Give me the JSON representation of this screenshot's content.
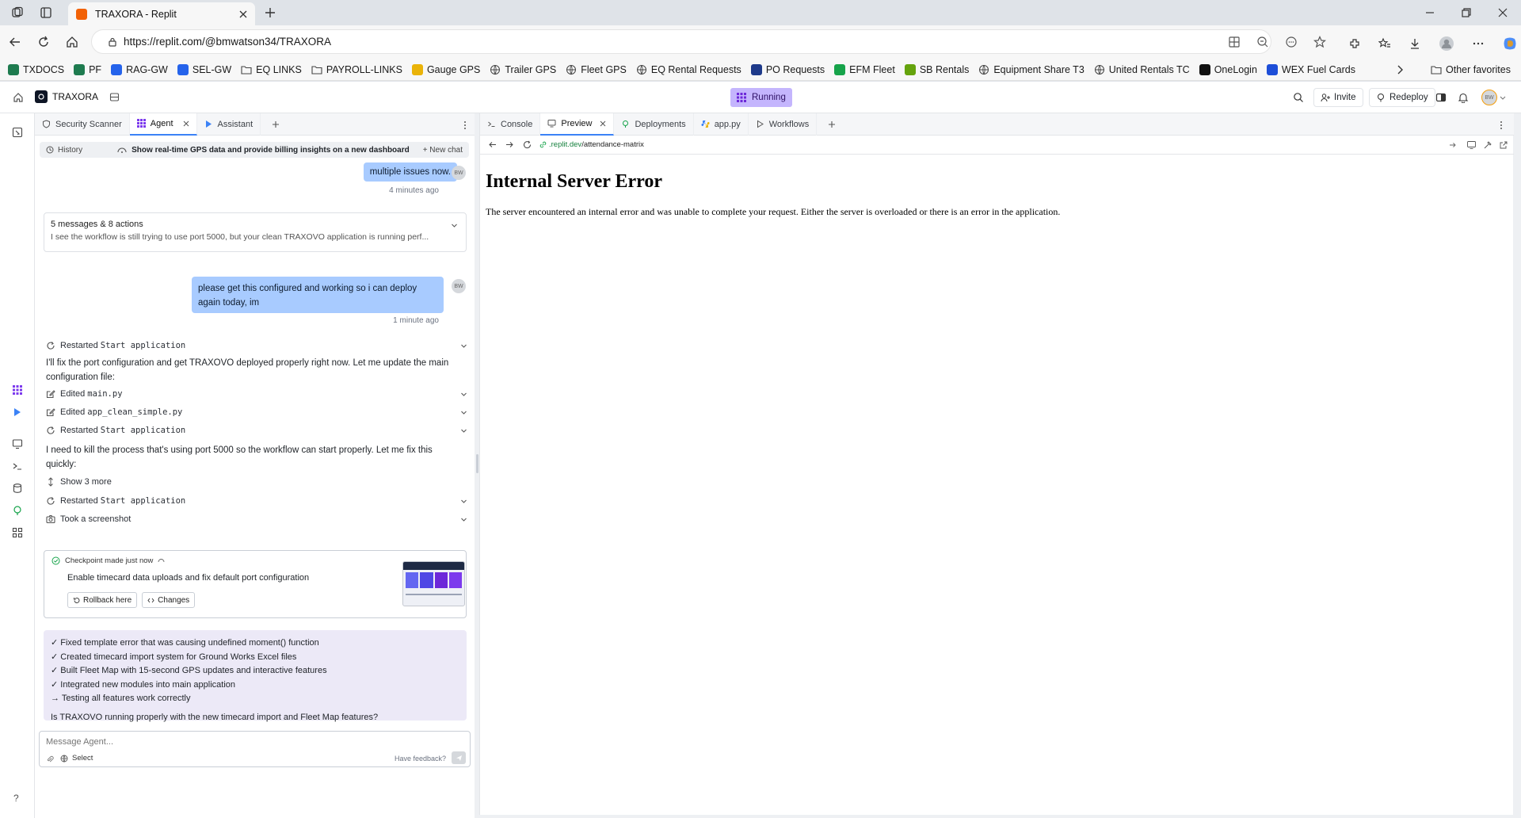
{
  "browser": {
    "tab_title": "TRAXORA - Replit",
    "url": "https://replit.com/@bmwatson34/TRAXORA",
    "bookmarks": [
      {
        "label": "TXDOCS",
        "color": "#1e7b4f"
      },
      {
        "label": "PF",
        "color": "#1e7b4f"
      },
      {
        "label": "RAG-GW",
        "color": "#2563eb"
      },
      {
        "label": "SEL-GW",
        "color": "#2563eb"
      },
      {
        "label": "EQ LINKS",
        "color": "folder"
      },
      {
        "label": "PAYROLL-LINKS",
        "color": "folder"
      },
      {
        "label": "Gauge GPS",
        "color": "#eab308"
      },
      {
        "label": "Trailer GPS",
        "color": "globe"
      },
      {
        "label": "Fleet GPS",
        "color": "globe"
      },
      {
        "label": "EQ Rental Requests",
        "color": "globe"
      },
      {
        "label": "PO Requests",
        "color": "#1e3a8a"
      },
      {
        "label": "EFM Fleet",
        "color": "#16a34a"
      },
      {
        "label": "SB Rentals",
        "color": "#65a30d"
      },
      {
        "label": "Equipment Share T3",
        "color": "globe"
      },
      {
        "label": "United Rentals TC",
        "color": "globe"
      },
      {
        "label": "OneLogin",
        "color": "#111"
      },
      {
        "label": "WEX Fuel Cards",
        "color": "#1d4ed8"
      }
    ],
    "other_favorites": "Other favorites"
  },
  "app": {
    "project_name": "TRAXORA",
    "status": "Running",
    "invite_label": "Invite",
    "redeploy_label": "Redeploy",
    "avatar_initials": "BW"
  },
  "agent_tabs": [
    "Security Scanner",
    "Agent",
    "Assistant"
  ],
  "chat_header": {
    "history_label": "History",
    "title": "Show real-time GPS data and provide billing insights on a new dashboard",
    "new_chat_label": "+ New chat"
  },
  "messages": {
    "user1": "multiple issues now.",
    "user1_time": "4 minutes ago",
    "summary_title": "5 messages & 8 actions",
    "summary_text": "I see the workflow is still trying to use port 5000, but your clean TRAXOVO application is running perf...",
    "user2": "please get this configured and working so i can deploy again today, im",
    "user2_time": "1 minute ago",
    "action_restart1_prefix": "Restarted",
    "action_restart1_code": "Start application",
    "agent_text1": "I'll fix the port configuration and get TRAXOVO deployed properly right now. Let me update the main configuration file:",
    "action_edit1_prefix": "Edited",
    "action_edit1_code": "main.py",
    "action_edit2_prefix": "Edited",
    "action_edit2_code": "app_clean_simple.py",
    "action_restart2_prefix": "Restarted",
    "action_restart2_code": "Start application",
    "agent_text2": "I need to kill the process that's using port 5000 so the workflow can start properly. Let me fix this quickly:",
    "show_more": "Show 3 more",
    "action_restart3_prefix": "Restarted",
    "action_restart3_code": "Start application",
    "action_screenshot": "Took a screenshot"
  },
  "checkpoint": {
    "label": "Checkpoint made just now",
    "description": "Enable timecard data uploads and fix default port configuration",
    "rollback_label": "Rollback here",
    "changes_label": "Changes"
  },
  "summary_box": {
    "lines": [
      "✓ Fixed template error that was causing undefined moment() function",
      "✓ Created timecard import system for Ground Works Excel files",
      "✓ Built Fleet Map with 15-second GPS updates and interactive features",
      "✓ Integrated new modules into main application",
      "→ Testing all features work correctly"
    ],
    "question": "Is TRAXOVO running properly with the new timecard import and Fleet Map features?"
  },
  "composer": {
    "placeholder": "Message Agent...",
    "select_label": "Select",
    "feedback_label": "Have feedback?"
  },
  "preview_tabs": [
    "Console",
    "Preview",
    "Deployments",
    "app.py",
    "Workflows"
  ],
  "preview": {
    "url_prefix": ".replit.dev",
    "url_path": "/attendance-matrix",
    "error_title": "Internal Server Error",
    "error_text": "The server encountered an internal error and was unable to complete your request. Either the server is overloaded or there is an error in the application."
  },
  "colors": {
    "running_badge": "#c4b5fd",
    "user_bubble": "#a8cbff",
    "summary_bg": "#ece9f7",
    "accent": "#3b82f6"
  }
}
